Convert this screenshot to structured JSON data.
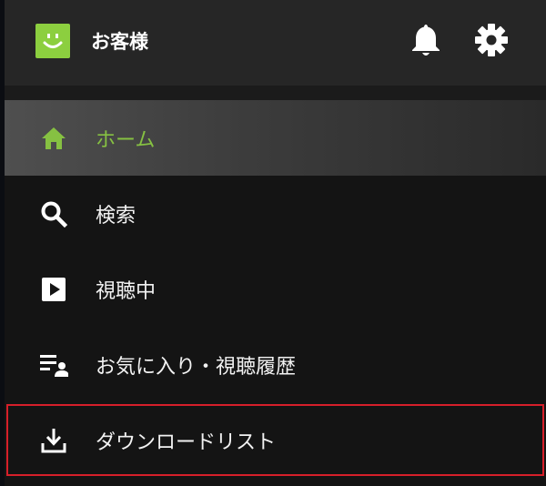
{
  "header": {
    "user_name": "お客様"
  },
  "menu": {
    "items": [
      {
        "label": "ホーム",
        "icon": "home-icon",
        "active": true
      },
      {
        "label": "検索",
        "icon": "search-icon",
        "active": false
      },
      {
        "label": "視聴中",
        "icon": "play-icon",
        "active": false
      },
      {
        "label": "お気に入り・視聴履歴",
        "icon": "favorites-list-icon",
        "active": false
      },
      {
        "label": "ダウンロードリスト",
        "icon": "download-icon",
        "active": false,
        "highlighted": true
      }
    ]
  },
  "colors": {
    "accent_green": "#86c142",
    "avatar_green": "#8ccf3f",
    "header_bg": "#262626",
    "menu_bg": "#141414",
    "highlight_border": "#d61f2a"
  }
}
